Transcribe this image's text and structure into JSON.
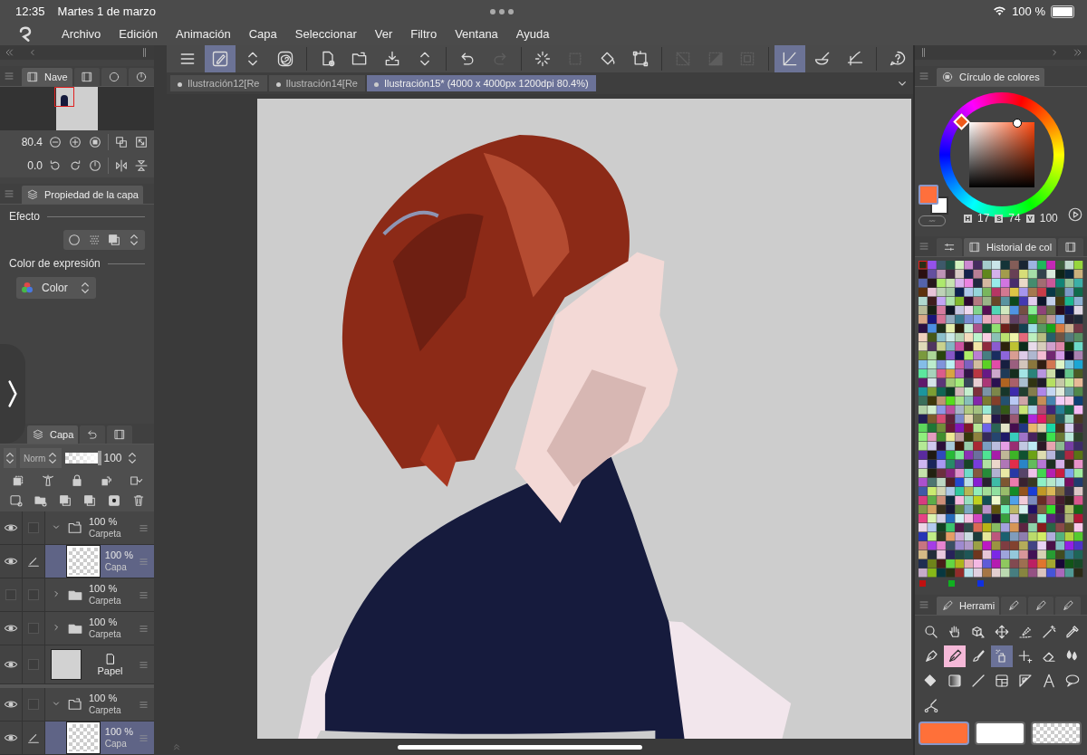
{
  "status_bar": {
    "time": "12:35",
    "date": "Martes 1 de marzo",
    "battery": "100 %"
  },
  "menu": [
    "Archivo",
    "Edición",
    "Animación",
    "Capa",
    "Seleccionar",
    "Ver",
    "Filtro",
    "Ventana",
    "Ayuda"
  ],
  "toolbar_groups": [
    {
      "buttons": [
        {
          "selected": false,
          "disabled": false
        },
        {
          "selected": true,
          "disabled": false
        },
        {
          "selected": false,
          "disabled": false
        },
        {
          "selected": false,
          "disabled": false
        }
      ]
    },
    {
      "buttons": [
        {
          "selected": false,
          "disabled": false
        },
        {
          "selected": false,
          "disabled": false
        },
        {
          "selected": false,
          "disabled": false
        },
        {
          "selected": false,
          "disabled": false
        }
      ]
    },
    {
      "buttons": [
        {
          "selected": false,
          "disabled": false
        },
        {
          "selected": false,
          "disabled": true
        }
      ]
    },
    {
      "buttons": [
        {
          "selected": false,
          "disabled": false
        },
        {
          "selected": false,
          "disabled": true
        },
        {
          "selected": false,
          "disabled": false
        },
        {
          "selected": false,
          "disabled": false
        }
      ]
    },
    {
      "buttons": [
        {
          "selected": false,
          "disabled": true
        },
        {
          "selected": false,
          "disabled": true
        },
        {
          "selected": false,
          "disabled": true
        }
      ]
    },
    {
      "buttons": [
        {
          "selected": true,
          "disabled": false
        },
        {
          "selected": false,
          "disabled": false
        },
        {
          "selected": false,
          "disabled": false
        }
      ]
    },
    {
      "buttons": [
        {
          "selected": false,
          "disabled": false
        }
      ]
    }
  ],
  "tabs": [
    {
      "label": "Ilustración12[Re",
      "selected": false
    },
    {
      "label": "Ilustración14[Re",
      "selected": false
    },
    {
      "label": "Ilustración15* (4000 x 4000px 1200dpi 80.4%)",
      "selected": true
    }
  ],
  "navigator": {
    "tab": "Nave",
    "zoom": "80.4",
    "angle": "0.0"
  },
  "layer_property": {
    "title": "Propiedad de la capa",
    "effect_label": "Efecto",
    "expression_label": "Color de expresión",
    "expression_value": "Color"
  },
  "layer_panel": {
    "tab": "Capa",
    "blend": "Norm",
    "opacity": "100",
    "opacity_slider": {
      "level": 1
    },
    "layers": [
      {
        "kind": "folder",
        "visible": true,
        "expanded": true,
        "selected": false,
        "opacity": "100 %",
        "name": "Carpeta",
        "children": [
          {
            "kind": "layer",
            "visible": true,
            "selected": true,
            "opacity": "100 %",
            "name": "Capa"
          }
        ]
      },
      {
        "kind": "folder",
        "visible": false,
        "expanded": false,
        "selected": false,
        "opacity": "100 %",
        "name": "Carpeta"
      },
      {
        "kind": "folder",
        "visible": true,
        "expanded": false,
        "selected": false,
        "opacity": "100 %",
        "name": "Carpeta"
      },
      {
        "kind": "paper",
        "visible": true,
        "selected": false,
        "name": "Papel"
      }
    ],
    "split_layers": [
      {
        "kind": "folder",
        "visible": true,
        "expanded": true,
        "selected": false,
        "opacity": "100 %",
        "name": "Carpeta",
        "children": [
          {
            "kind": "layer",
            "visible": true,
            "selected": true,
            "opacity": "100 %",
            "name": "Capa"
          }
        ]
      }
    ]
  },
  "color_wheel": {
    "title": "Círculo de colores",
    "swatches": [
      {
        "kind": "main",
        "color": "#ff6f3c"
      },
      {
        "kind": "sub",
        "color": "#ffffff"
      }
    ],
    "hsv": [
      {
        "letter": "H",
        "value": "17"
      },
      {
        "letter": "S",
        "value": "74"
      },
      {
        "letter": "V",
        "value": "100"
      }
    ]
  },
  "history": {
    "title": "Historial de col"
  },
  "tools_panel": {
    "title": "Herrami"
  },
  "tools": [
    {
      "selected": false,
      "pressed": false
    },
    {
      "selected": false,
      "pressed": false
    },
    {
      "selected": false,
      "pressed": false
    },
    {
      "selected": false,
      "pressed": false
    },
    {
      "selected": false,
      "pressed": false
    },
    {
      "selected": false,
      "pressed": false
    },
    {
      "selected": false,
      "pressed": false
    },
    {
      "selected": false,
      "pressed": false
    },
    {
      "selected": true,
      "pressed": false
    },
    {
      "selected": false,
      "pressed": false
    },
    {
      "selected": false,
      "pressed": true
    },
    {
      "selected": false,
      "pressed": false
    },
    {
      "selected": false,
      "pressed": false
    },
    {
      "selected": false,
      "pressed": false
    },
    {
      "selected": false,
      "pressed": false
    },
    {
      "selected": false,
      "pressed": false
    },
    {
      "selected": false,
      "pressed": false
    },
    {
      "selected": false,
      "pressed": false
    },
    {
      "selected": false,
      "pressed": false
    },
    {
      "selected": false,
      "pressed": false
    },
    {
      "selected": false,
      "pressed": false
    },
    {
      "selected": false,
      "pressed": false
    }
  ],
  "color_slots": [
    {
      "kind": "color",
      "color": "#ff7039",
      "selected": true
    },
    {
      "kind": "color",
      "color": "#ffffff",
      "selected": false
    },
    {
      "kind": "transparent",
      "selected": false
    }
  ]
}
